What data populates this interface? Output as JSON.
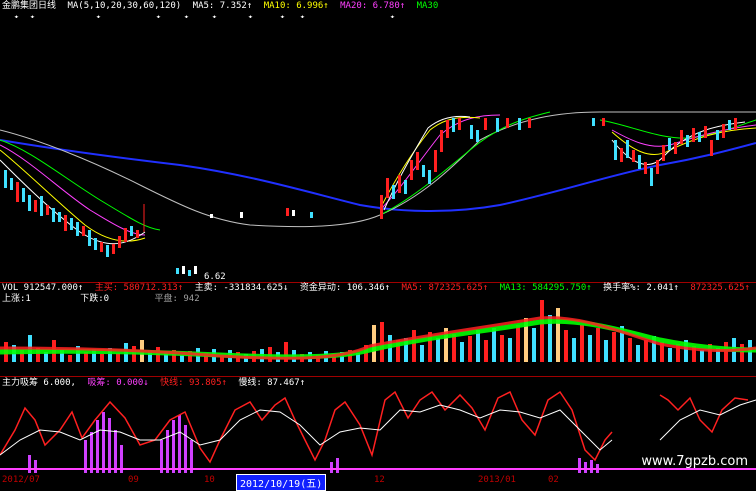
{
  "header": {
    "title": "金鹏集团日线",
    "ma_group": "MA(5,10,20,30,60,120)",
    "ma5": "MA5: 7.352↑",
    "ma10": "MA10: 6.996↑",
    "ma20": "MA20: 6.780↑",
    "ma30": "MA30"
  },
  "price_label": "6.62",
  "vol_row": {
    "vol": "VOL 912547.000↑",
    "main_buy": "主买: 580712.313↑",
    "main_sell": "主卖: -331834.625↓",
    "fund_flow": "资金异动: 106.346↑",
    "ma5": "MA5: 872325.625↑",
    "ma13": "MA13: 584295.750↑",
    "turnover": "换手率%: 2.041↑",
    "ma_extra": "872325.625↑"
  },
  "sub_row": {
    "up": "上涨:1",
    "down": "下跌:0",
    "flat": "平盘: 942"
  },
  "ind_row": {
    "name": "主力吸筹 6.000,",
    "absorb": "吸筹: 0.000↓",
    "fast": "快线: 93.805↑",
    "slow": "慢线: 87.467↑"
  },
  "date_axis": {
    "d1": "2012/07",
    "d2": "09",
    "d3": "10",
    "selected": "2012/10/19(五)",
    "d4": "12",
    "d5": "2013/01",
    "d6": "02"
  },
  "watermark": "www.7gpzb.com",
  "colors": {
    "up": "#ff2020",
    "down": "#40e0ff",
    "ma5": "#ffffff",
    "ma10": "#ffff00",
    "ma20": "#ff40ff",
    "ma30": "#00ff00",
    "ma60": "#c0c0c0",
    "ma120": "#2030ff"
  }
}
